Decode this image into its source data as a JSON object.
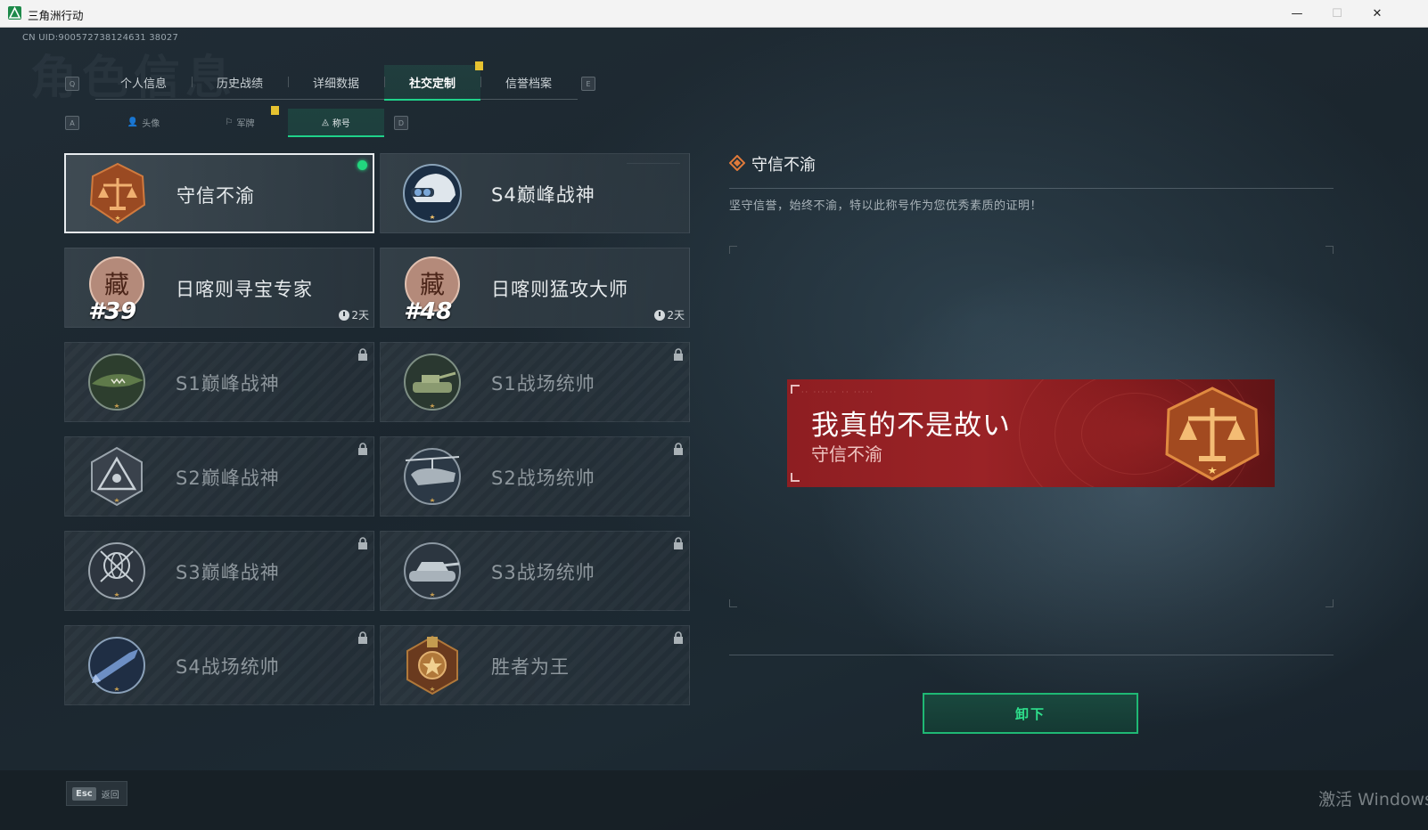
{
  "window": {
    "title": "三角洲行动",
    "minimize": "—",
    "maximize": "☐",
    "close": "✕"
  },
  "uid": "CN UID:900572738124631 38027",
  "bg_title": "角色信息",
  "tabs": {
    "prev_key": "Q",
    "next_key": "E",
    "items": [
      {
        "label": "个人信息"
      },
      {
        "label": "历史战绩"
      },
      {
        "label": "详细数据"
      },
      {
        "label": "社交定制"
      },
      {
        "label": "信誉档案"
      }
    ]
  },
  "subtabs": {
    "prev_key": "A",
    "next_key": "D",
    "items": [
      {
        "label": "头像",
        "icon": "person-icon"
      },
      {
        "label": "军牌",
        "icon": "tag-icon"
      },
      {
        "label": "称号",
        "icon": "title-icon"
      }
    ]
  },
  "titles": [
    {
      "name": "守信不渝",
      "state": "equipped"
    },
    {
      "name": "S4巅峰战神",
      "state": "owned"
    },
    {
      "name": "日喀则寻宝专家",
      "state": "timed",
      "rank": "#39",
      "timer": "2天"
    },
    {
      "name": "日喀则猛攻大师",
      "state": "timed",
      "rank": "#48",
      "timer": "2天"
    },
    {
      "name": "S1巅峰战神",
      "state": "locked"
    },
    {
      "name": "S1战场统帅",
      "state": "locked"
    },
    {
      "name": "S2巅峰战神",
      "state": "locked"
    },
    {
      "name": "S2战场统帅",
      "state": "locked"
    },
    {
      "name": "S3巅峰战神",
      "state": "locked"
    },
    {
      "name": "S3战场统帅",
      "state": "locked"
    },
    {
      "name": "S4战场统帅",
      "state": "locked"
    },
    {
      "name": "胜者为王",
      "state": "locked"
    }
  ],
  "detail": {
    "title": "守信不渝",
    "description": "坚守信誉，始终不渝，特以此称号作为您优秀素质的证明！",
    "banner_nickname": "我真的不是故い",
    "banner_title": "守信不渝",
    "unequip_label": "卸下"
  },
  "footer": {
    "esc_key": "Esc",
    "esc_label": "返回",
    "watermark": "激活 Windows"
  },
  "colors": {
    "accent_green": "#1fd28a",
    "banner_red": "#9a2326",
    "notice_yellow": "#e6c230"
  }
}
